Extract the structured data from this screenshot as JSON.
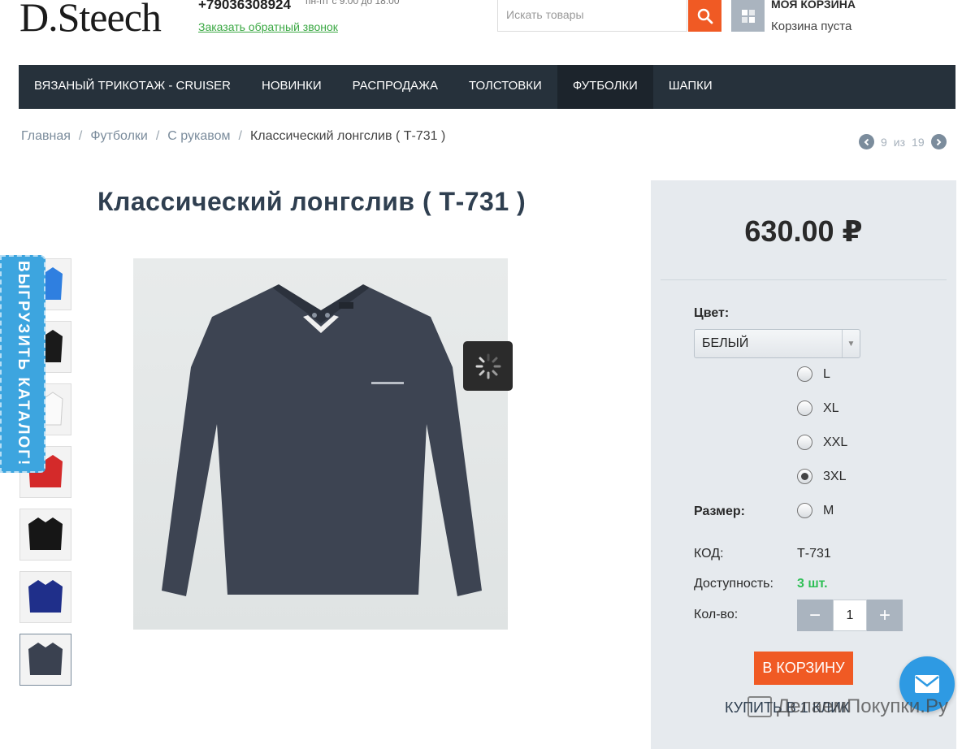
{
  "header": {
    "logo": "D.Steech",
    "phone": "+79036308924",
    "hours": "пн-пт с 9:00 до 18:00",
    "callback_link": "Заказать обратный звонок",
    "search_placeholder": "Искать товары",
    "cart_title": "МОЯ КОРЗИНА",
    "cart_status": "Корзина пуста",
    "accent_color": "#f05a24"
  },
  "nav": {
    "items": [
      {
        "label": "ВЯЗАНЫЙ ТРИКОТАЖ - CRUISER"
      },
      {
        "label": "НОВИНКИ"
      },
      {
        "label": "РАСПРОДАЖА"
      },
      {
        "label": "ТОЛСТОВКИ"
      },
      {
        "label": "ФУТБОЛКИ"
      },
      {
        "label": "ШАПКИ"
      }
    ],
    "active_label": "ФУТБОЛКИ"
  },
  "breadcrumb": {
    "items": [
      "Главная",
      "Футболки",
      "С рукавом"
    ],
    "current": "Классический лонгслив ( Т-731 )",
    "separator": "/"
  },
  "pager": {
    "current": "9",
    "of_label": "из",
    "total": "19"
  },
  "product": {
    "title": "Классический лонгслив ( Т-731 )",
    "price": "630.00 ₽",
    "color_label": "Цвет:",
    "color_value": "БЕЛЫЙ",
    "size_label": "Размер:",
    "sizes": [
      {
        "label": "L",
        "checked": false
      },
      {
        "label": "XL",
        "checked": false
      },
      {
        "label": "XXL",
        "checked": false
      },
      {
        "label": "3XL",
        "checked": true
      },
      {
        "label": "M",
        "checked": false
      }
    ],
    "code_label": "КОД:",
    "code_value": "Т-731",
    "availability_label": "Доступность:",
    "availability_value": "3 шт.",
    "qty_label": "Кол-во:",
    "qty_value": "1",
    "qty_minus": "−",
    "qty_plus": "+",
    "add_to_cart": "В КОРЗИНУ",
    "buy_one_click": "КУПИТЬ В 1 КЛИК"
  },
  "catalog_tab": "ВЫГРУЗИТЬ КАТАЛОГ!",
  "thumbnails": [
    {
      "color": "#2f7fe0"
    },
    {
      "color": "#1a1a1a"
    },
    {
      "color": "#f4f4f4"
    },
    {
      "color": "#d42a2a"
    },
    {
      "color": "#161616"
    },
    {
      "color": "#1f2f8a"
    },
    {
      "color": "#3a4150"
    }
  ],
  "watermark": "ДелаемПокупки.Ру"
}
